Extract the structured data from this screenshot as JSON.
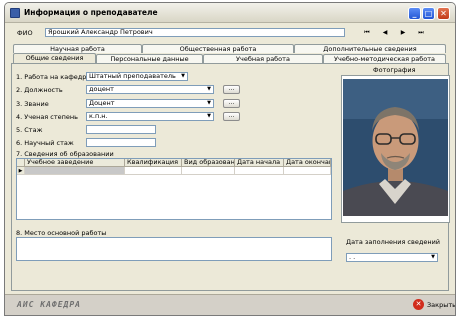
{
  "window": {
    "title": "Информация о преподавателе",
    "minimize_glyph": "_",
    "maximize_glyph": "□",
    "close_glyph": "✕"
  },
  "header": {
    "fio_label": "ФИО",
    "fio_value": "Ярошкий Александр Петрович",
    "nav": {
      "first": "⏮",
      "prev": "◀",
      "next": "▶",
      "last": "⏭"
    }
  },
  "tabs": {
    "row1": [
      "Научная работа",
      "Общественная работа",
      "Дополнительные сведения"
    ],
    "row2": [
      "Общие сведения",
      "Персональные данные",
      "Учебная работа",
      "Учебно-методическая работа"
    ],
    "active": "Общие сведения"
  },
  "form": {
    "work_label": "1. Работа на кафедре",
    "work_value": "Штатный преподаватель",
    "position_label": "2. Должность",
    "position_value": "доцент",
    "rank_label": "3. Звание",
    "rank_value": "Доцент",
    "degree_label": "4. Ученая степень",
    "degree_value": "к.п.н.",
    "experience_label": "5. Стаж",
    "experience_value": "",
    "sci_experience_label": "6. Научный стаж",
    "sci_experience_value": "",
    "dots_label": "...",
    "education_label": "7. Сведения об образовании",
    "education_columns": [
      "Учебное заведение",
      "Квалификация",
      "Вид образования",
      "Дата начала",
      "Дата окончания"
    ],
    "row_indicator": "▶",
    "workplace_label": "8. Место основной работы",
    "workplace_value": ""
  },
  "photo": {
    "label": "Фотография"
  },
  "fill_date": {
    "label": "Дата заполнения сведений",
    "value": ". ."
  },
  "footer": {
    "brand": "АИС КАФЕДРА",
    "close_label": "Закрыть"
  },
  "colors": {
    "window_bg": "#ece9d8",
    "title_blue": "#2357d4",
    "close_red": "#d12c1c"
  }
}
